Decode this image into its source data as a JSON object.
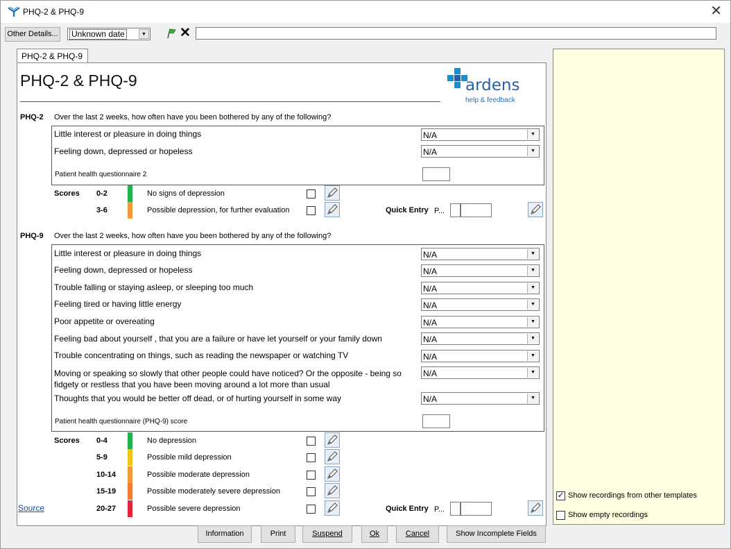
{
  "window": {
    "title": "PHQ-2 & PHQ-9"
  },
  "toolbar": {
    "other_details": "Other Details...",
    "date_value": "Unknown date"
  },
  "tab": {
    "label": "PHQ-2 & PHQ-9"
  },
  "form": {
    "heading": "PHQ-2 & PHQ-9"
  },
  "logo": {
    "name": "ardens",
    "tagline": "help & feedback"
  },
  "phq2": {
    "label": "PHQ-2",
    "question": "Over the last 2 weeks, how often have you been bothered by any of the following?",
    "items": [
      {
        "text": "Little interest or pleasure in doing things",
        "value": "N/A"
      },
      {
        "text": "Feeling down, depressed or hopeless",
        "value": "N/A"
      }
    ],
    "score_label": "Patient health questionnaire 2",
    "scores_title": "Scores",
    "scores": [
      {
        "range": "0-2",
        "text": "No signs of depression",
        "color": "#21b24b"
      },
      {
        "range": "3-6",
        "text": "Possible depression, for further evaluation",
        "color": "#f39a3a"
      }
    ],
    "quick_entry": "Quick Entry",
    "quick_prefix": "P..."
  },
  "phq9": {
    "label": "PHQ-9",
    "question": "Over the last 2 weeks, how often have you been bothered by any of the following?",
    "items": [
      {
        "text": "Little interest or pleasure in doing things",
        "value": "N/A"
      },
      {
        "text": "Feeling down, depressed or hopeless",
        "value": "N/A"
      },
      {
        "text": "Trouble falling or staying asleep, or sleeping too much",
        "value": "N/A"
      },
      {
        "text": "Feeling tired or having little energy",
        "value": "N/A"
      },
      {
        "text": "Poor appetite or overeating",
        "value": "N/A"
      },
      {
        "text": "Feeling bad about yourself , that you are a failure or have let yourself or your family down",
        "value": "N/A"
      },
      {
        "text": "Trouble concentrating on things, such as reading the newspaper or watching TV",
        "value": "N/A"
      },
      {
        "text": "Moving or speaking so slowly that other people could have noticed? Or the opposite - being so fidgety or restless that you have been moving around a lot more than usual",
        "value": "N/A"
      },
      {
        "text": "Thoughts that you would be better off dead, or of hurting yourself in some way",
        "value": "N/A"
      }
    ],
    "score_label": "Patient health questionnaire (PHQ-9) score",
    "scores_title": "Scores",
    "scores": [
      {
        "range": "0-4",
        "text": "No depression",
        "color": "#21b24b"
      },
      {
        "range": "5-9",
        "text": "Possible mild depression",
        "color": "#f2c418"
      },
      {
        "range": "10-14",
        "text": "Possible moderate depression",
        "color": "#f39a3a"
      },
      {
        "range": "15-19",
        "text": "Possible moderately severe depression",
        "color": "#f07f33"
      },
      {
        "range": "20-27",
        "text": "Possible severe depression",
        "color": "#e2253a"
      }
    ],
    "quick_entry": "Quick Entry",
    "quick_prefix": "P..."
  },
  "source_link": "Source",
  "right": {
    "show_other": {
      "label": "Show recordings from other templates",
      "checked": true
    },
    "show_empty": {
      "label": "Show empty recordings",
      "checked": false
    }
  },
  "buttons": {
    "information": "Information",
    "print": "Print",
    "suspend": "Suspend",
    "ok": "Ok",
    "cancel": "Cancel",
    "show_incomplete": "Show Incomplete Fields"
  }
}
